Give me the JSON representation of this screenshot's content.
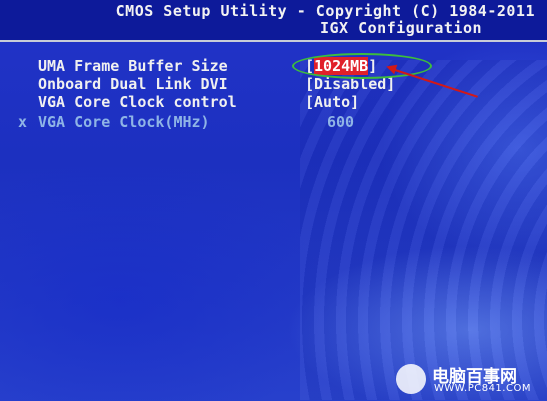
{
  "header": {
    "title": "CMOS Setup Utility - Copyright (C) 1984-2011",
    "subtitle": "IGX Configuration"
  },
  "settings": [
    {
      "label": "UMA Frame Buffer Size",
      "value_open": "[",
      "value_text": "1024MB",
      "value_close": "]",
      "selected": true,
      "disabled": false
    },
    {
      "label": "Onboard Dual Link DVI",
      "value_open": "[",
      "value_text": "Disabled",
      "value_close": "]",
      "selected": false,
      "disabled": false
    },
    {
      "label": "VGA Core Clock control",
      "value_open": "[",
      "value_text": "Auto",
      "value_close": "]",
      "selected": false,
      "disabled": false
    },
    {
      "marker": "x",
      "label": "VGA Core Clock(MHz)",
      "value_text": "600",
      "selected": false,
      "disabled": true
    }
  ],
  "watermark": {
    "name": "电脑百事网",
    "url": "WWW.PC841.COM"
  },
  "colors": {
    "background": "#1c30c0",
    "header_bg": "#0d1a9a",
    "text": "#f0f0f0",
    "disabled_text": "#8fb4e6",
    "highlight": "#e0202a",
    "annotation_ellipse": "#3dbd3d",
    "annotation_arrow": "#d21818"
  }
}
